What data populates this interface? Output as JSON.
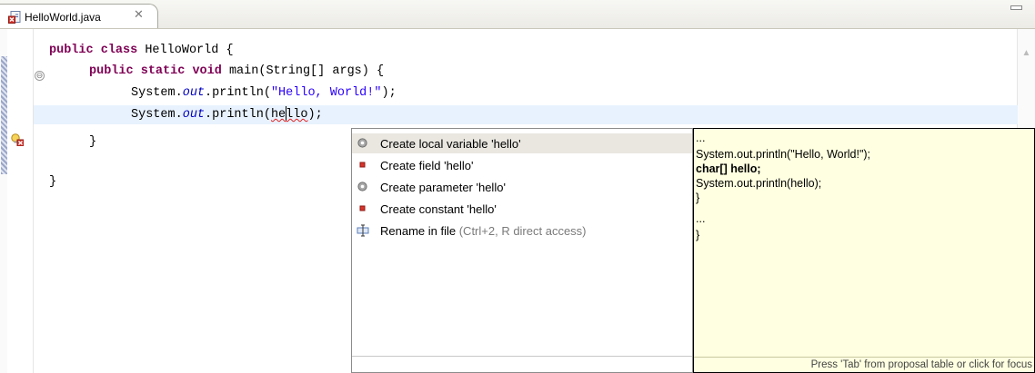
{
  "tab": {
    "title": "HelloWorld.java",
    "close_glyph": "✕"
  },
  "gutter": {
    "fold_glyph": "⊖",
    "scroll_up_glyph": "▲"
  },
  "code": {
    "line1": {
      "kw1": "public",
      "kw2": "class",
      "rest": " HelloWorld {"
    },
    "line2": {
      "kw1": "public",
      "kw2": "static",
      "kw3": "void",
      "rest": " main(String[] args) {"
    },
    "line3": {
      "prefix": "System.",
      "field": "out",
      "mid": ".println(",
      "string": "\"Hello, World!\"",
      "suffix": ");"
    },
    "line4": {
      "prefix": "System.",
      "field": "out",
      "mid": ".println(",
      "err_a": "he",
      "err_b": "llo",
      "suffix": ");"
    },
    "line5": "}",
    "line6": "}"
  },
  "proposals": [
    {
      "label": "Create local variable 'hello'",
      "hint": "",
      "icon": "local-variable-icon",
      "selected": true
    },
    {
      "label": "Create field 'hello'",
      "hint": "",
      "icon": "private-field-icon",
      "selected": false
    },
    {
      "label": "Create parameter 'hello'",
      "hint": "",
      "icon": "local-variable-icon",
      "selected": false
    },
    {
      "label": "Create constant 'hello'",
      "hint": "",
      "icon": "private-field-icon",
      "selected": false
    },
    {
      "label": "Rename in file",
      "hint": " (Ctrl+2, R direct access)",
      "icon": "rename-icon",
      "selected": false
    }
  ],
  "info": {
    "lines": [
      "...",
      "System.out.println(\"Hello, World!\");",
      "char[] hello;",
      "System.out.println(hello);",
      "}",
      "...",
      "}"
    ],
    "status": "Press 'Tab' from proposal table or click for focus"
  },
  "colors": {
    "keyword": "#7f0055",
    "string": "#2a00ff",
    "field": "#0000c0",
    "info_bg": "#ffffe1",
    "selection": "#e9e7e0"
  }
}
